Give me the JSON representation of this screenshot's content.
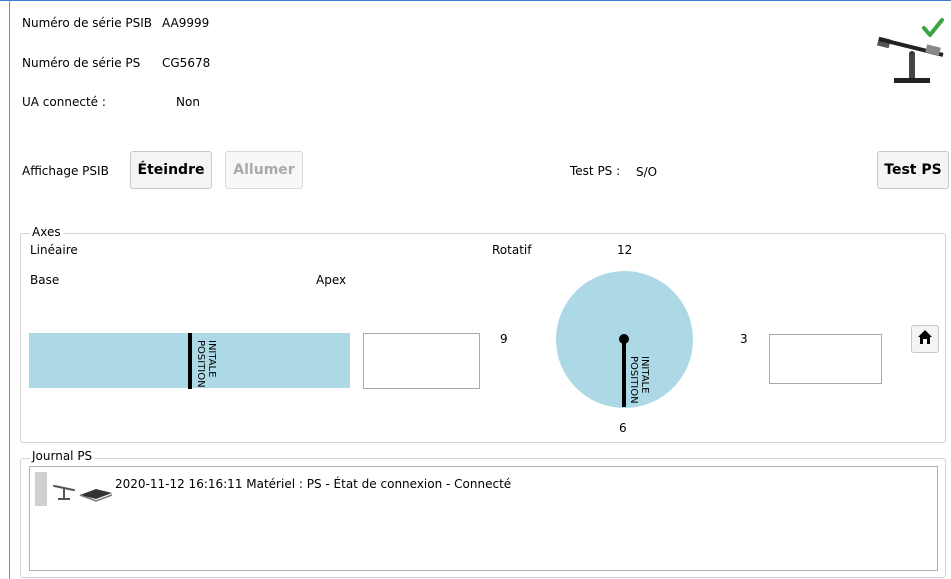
{
  "info": {
    "psib_serial_label": "Numéro de série PSIB",
    "psib_serial_value": "AA9999",
    "ps_serial_label": "Numéro de série PS",
    "ps_serial_value": "CG5678",
    "ua_label": "UA connecté :",
    "ua_value": "Non"
  },
  "display": {
    "label": "Affichage PSIB",
    "off_button": "Éteindre",
    "on_button": "Allumer"
  },
  "test": {
    "label": "Test PS :",
    "value": "S/O",
    "button": "Test PS"
  },
  "axes": {
    "title": "Axes",
    "linear_label": "Linéaire",
    "base_label": "Base",
    "apex_label": "Apex",
    "linear_position_label_1": "POSITION",
    "linear_position_label_2": "INITALE",
    "linear_value": "",
    "rotary_label": "Rotatif",
    "dial_12": "12",
    "dial_3": "3",
    "dial_6": "6",
    "dial_9": "9",
    "rotary_position_label_1": "POSITION",
    "rotary_position_label_2": "INITALE",
    "rotary_value": "",
    "home_icon": "home-icon"
  },
  "journal": {
    "title": "Journal PS",
    "entries": [
      {
        "text": "2020-11-12 16:16:11 Matériel : PS - État de connexion - Connecté",
        "icons": [
          "seesaw-icon",
          "chip-icon"
        ]
      }
    ]
  },
  "colors": {
    "accent_blue": "#add8e6",
    "check_green": "#3aa640"
  }
}
